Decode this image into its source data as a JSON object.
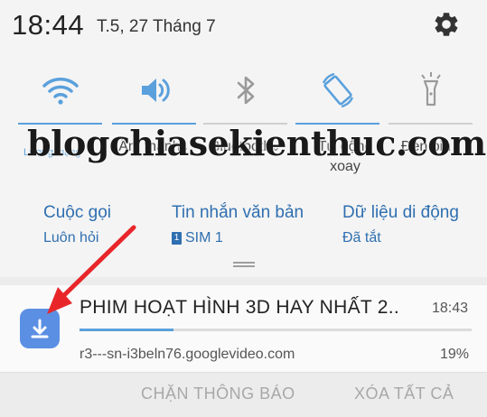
{
  "status": {
    "time": "18:44",
    "date": "T.5, 27 Tháng 7"
  },
  "tiles": [
    {
      "name": "wifi",
      "label": "Lượng mạng",
      "active": true
    },
    {
      "name": "sound",
      "label": "Âm thanh",
      "active": true
    },
    {
      "name": "bluetooth",
      "label": "Bluetooth",
      "active": false
    },
    {
      "name": "rotate",
      "label": "Tự động xoay",
      "active": true
    },
    {
      "name": "flashlight",
      "label": "Đèn pin",
      "active": false
    }
  ],
  "watermark": "blogchiasekienthuc.com",
  "shortcuts": {
    "calls": {
      "title": "Cuộc gọi",
      "sub": "Luôn hỏi"
    },
    "messages": {
      "title": "Tin nhắn văn bản",
      "sim_badge": "1",
      "sub": "SIM 1"
    },
    "data": {
      "title": "Dữ liệu di động",
      "sub": "Đã tắt"
    }
  },
  "notification": {
    "title": "PHIM HOẠT HÌNH 3D HAY NHẤT 2..",
    "time": "18:43",
    "source": "r3---sn-i3beln76.googlevideo.com",
    "percent_text": "19%",
    "progress": 0.24,
    "icon": "download-icon"
  },
  "actions": {
    "block": "CHẶN THÔNG BÁO",
    "clear": "XÓA TẤT CẢ"
  },
  "colors": {
    "accent": "#5aa0dc",
    "link": "#2f6fb0",
    "icon_bg": "#5b8fe3",
    "arrow": "#e8262a"
  }
}
